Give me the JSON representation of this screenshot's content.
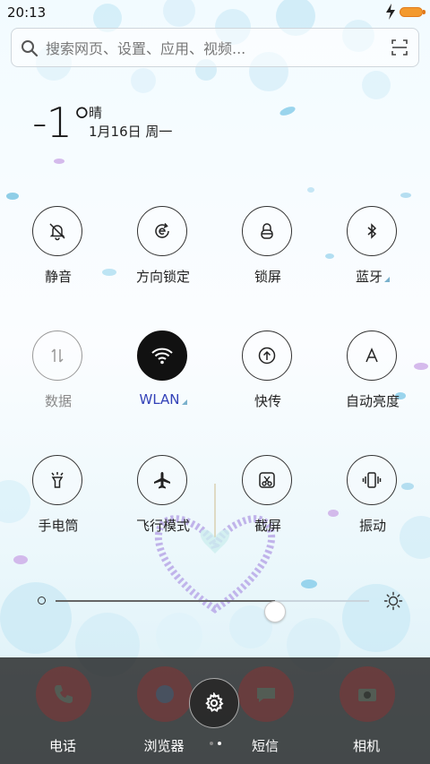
{
  "status_bar": {
    "time": "20:13"
  },
  "search": {
    "placeholder": "搜索网页、设置、应用、视频..."
  },
  "weather": {
    "temperature": "-1°",
    "condition": "晴",
    "date": "1月16日 周一"
  },
  "toggles": [
    {
      "label": "静音",
      "icon": "bell-off-icon"
    },
    {
      "label": "方向锁定",
      "icon": "rotation-lock-icon"
    },
    {
      "label": "锁屏",
      "icon": "lock-icon"
    },
    {
      "label": "蓝牙",
      "icon": "bluetooth-icon",
      "has_settings": true
    },
    {
      "label": "数据",
      "icon": "data-icon",
      "state": "disabled"
    },
    {
      "label": "WLAN",
      "icon": "wifi-icon",
      "state": "on",
      "has_settings": true
    },
    {
      "label": "快传",
      "icon": "upload-icon"
    },
    {
      "label": "自动亮度",
      "icon": "auto-brightness-icon"
    },
    {
      "label": "手电筒",
      "icon": "flashlight-icon"
    },
    {
      "label": "飞行模式",
      "icon": "airplane-icon"
    },
    {
      "label": "截屏",
      "icon": "screenshot-icon"
    },
    {
      "label": "振动",
      "icon": "vibrate-icon"
    }
  ],
  "brightness": {
    "level": 0.7
  },
  "dock": [
    {
      "label": "电话",
      "icon": "phone-icon"
    },
    {
      "label": "浏览器",
      "icon": "browser-icon"
    },
    {
      "label": "短信",
      "icon": "messages-icon"
    },
    {
      "label": "相机",
      "icon": "camera-icon"
    }
  ],
  "page_indicator": {
    "count": 2,
    "active": 1
  },
  "colors": {
    "active_label": "#3342b8",
    "battery": "#f39a2e",
    "accent": "#111111"
  }
}
